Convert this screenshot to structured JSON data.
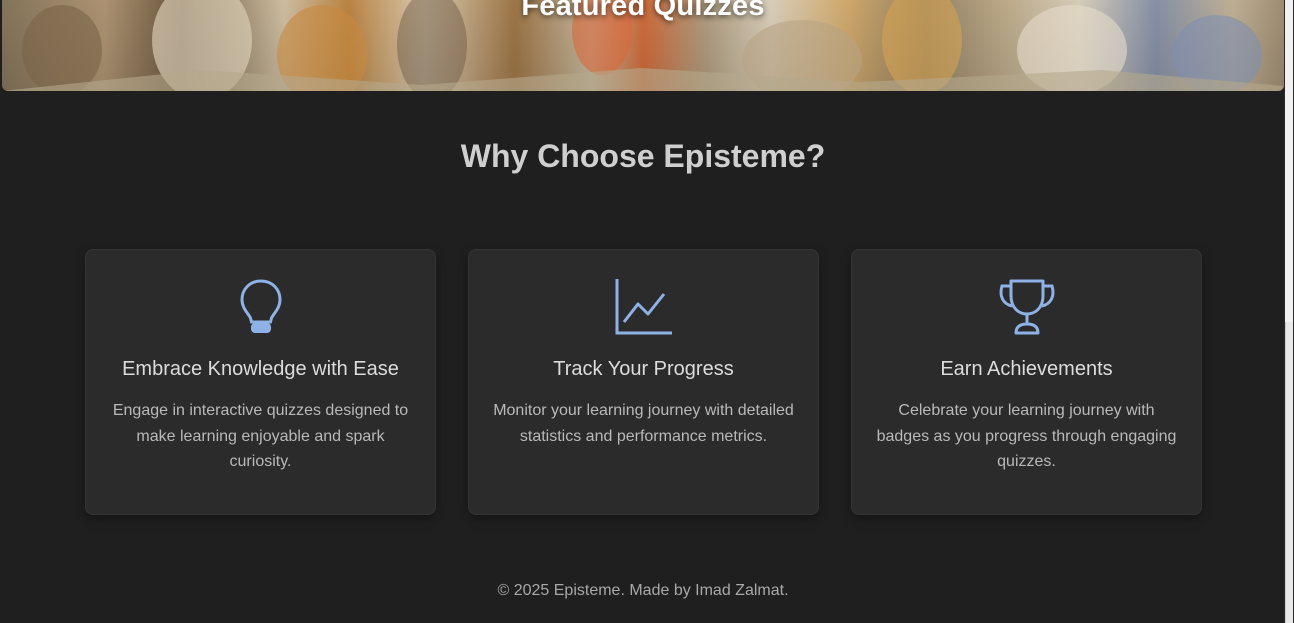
{
  "hero": {
    "title": "Featured Quizzes"
  },
  "why_section": {
    "title": "Why Choose Episteme?"
  },
  "cards": [
    {
      "icon": "lightbulb-icon",
      "title": "Embrace Knowledge with Ease",
      "text": "Engage in interactive quizzes designed to make learning enjoyable and spark curiosity."
    },
    {
      "icon": "chart-line-icon",
      "title": "Track Your Progress",
      "text": "Monitor your learning journey with detailed statistics and performance metrics."
    },
    {
      "icon": "trophy-icon",
      "title": "Earn Achievements",
      "text": "Celebrate your learning journey with badges as you progress through engaging quizzes."
    }
  ],
  "footer": {
    "text": "© 2025 Episteme. Made by Imad Zalmat."
  },
  "colors": {
    "background": "#1f1f1f",
    "card": "#2b2b2b",
    "icon_accent": "#8fb2e6"
  }
}
